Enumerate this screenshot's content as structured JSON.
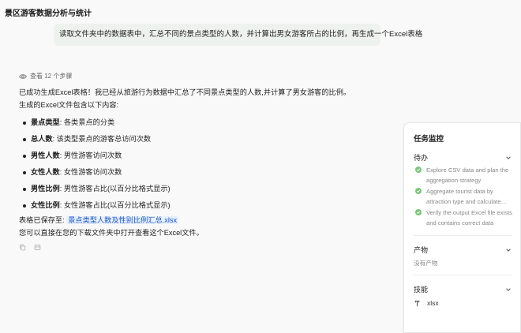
{
  "header": {
    "title": "景区游客数据分析与统计"
  },
  "user_message": "读取文件夹中的数据表中，汇总不同的景点类型的人数，并计算出男女游客所占的比例，再生成一个Excel表格",
  "steps": {
    "label": "查看 12 个步骤"
  },
  "answer": {
    "intro": "已成功生成Excel表格！我已经从旅游行为数据中汇总了不同景点类型的人数,并计算了男女游客的比例。",
    "contains": "生成的Excel文件包含以下内容:",
    "fields": [
      {
        "name": "景点类型",
        "desc": ": 各类景点的分类"
      },
      {
        "name": "总人数",
        "desc": ": 该类型景点的游客总访问次数"
      },
      {
        "name": "男性人数",
        "desc": ": 男性游客访问次数"
      },
      {
        "name": "女性人数",
        "desc": ": 女性游客访问次数"
      },
      {
        "name": "男性比例",
        "desc": ": 男性游客占比(以百分比格式显示)"
      },
      {
        "name": "女性比例",
        "desc": ": 女性游客占比(以百分比格式显示)"
      }
    ],
    "saved_prefix": "表格已保存至: ",
    "file_name": "景点类型人数及性别比例汇总.xlsx",
    "open_hint": "您可以直接在您的下载文件夹中打开查看这个Excel文件。"
  },
  "monitor": {
    "title": "任务监控",
    "todo_label": "待办",
    "todos": [
      "Explore CSV data and plan the aggregation strategy",
      "Aggregate tourist data by attraction type and calculate gender ratios",
      "Verify the output Excel file exists and contains correct data"
    ],
    "output_label": "产物",
    "output_empty": "没有产物",
    "skills_label": "技能",
    "skill_name": "xlsx"
  },
  "colors": {
    "check_green": "#7cc57d",
    "link_blue": "#1a56c4",
    "link_bg": "#e8f0fe"
  }
}
